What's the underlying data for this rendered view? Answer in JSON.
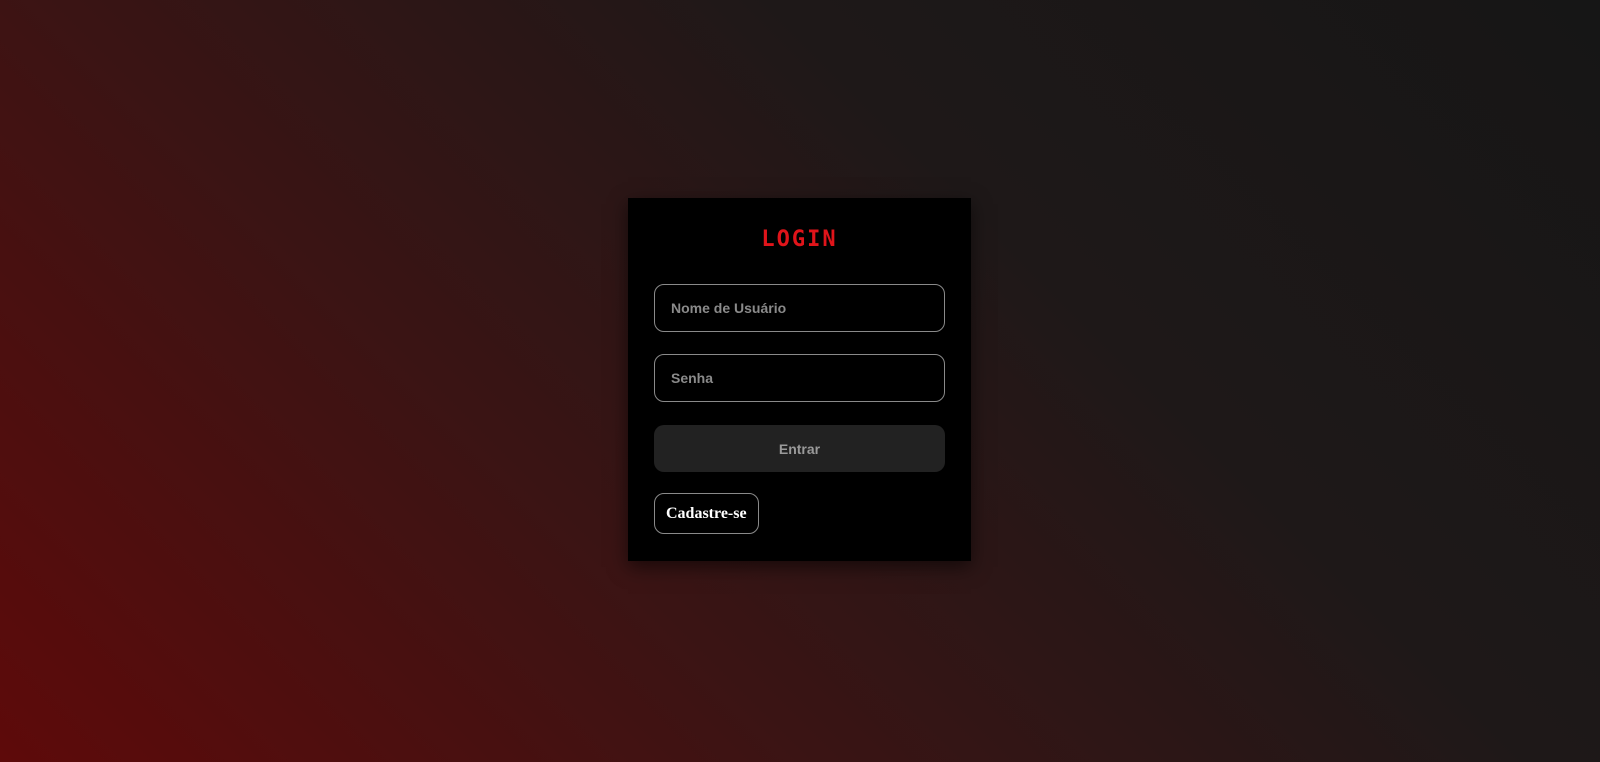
{
  "login": {
    "title": "LOGIN",
    "username_placeholder": "Nome de Usuário",
    "username_value": "",
    "password_placeholder": "Senha",
    "password_value": "",
    "submit_label": "Entrar",
    "register_label": "Cadastre-se"
  },
  "colors": {
    "accent": "#e0141a",
    "card_background": "#000000",
    "button_background": "#222222",
    "gradient_dark_red": "#5e0a0a",
    "gradient_dark_gray": "#161616"
  }
}
